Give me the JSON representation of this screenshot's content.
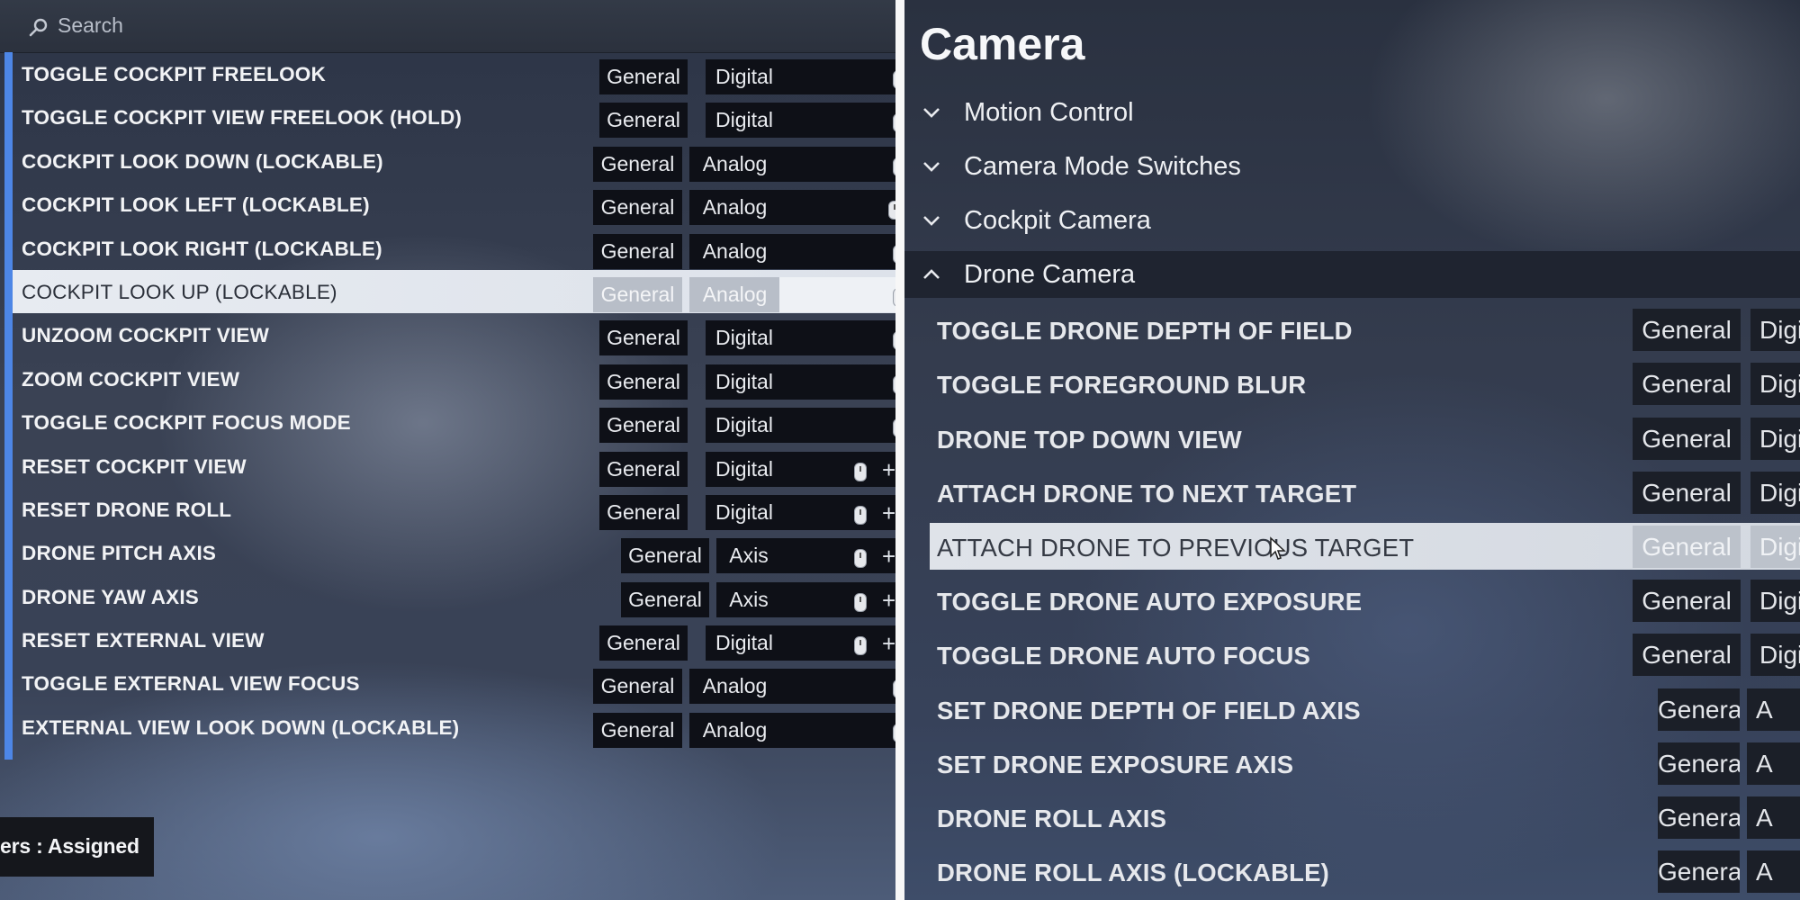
{
  "left_panel": {
    "search": {
      "placeholder": "Search"
    },
    "rows": [
      {
        "name": "TOGGLE COCKPIT FREELOOK",
        "category": "General",
        "type": "Digital"
      },
      {
        "name": "TOGGLE COCKPIT VIEW FREELOOK (HOLD)",
        "category": "General",
        "type": "Digital"
      },
      {
        "name": "COCKPIT LOOK DOWN (LOCKABLE)",
        "category": "General",
        "type": "Analog"
      },
      {
        "name": "COCKPIT LOOK LEFT (LOCKABLE)",
        "category": "General",
        "type": "Analog"
      },
      {
        "name": "COCKPIT LOOK RIGHT (LOCKABLE)",
        "category": "General",
        "type": "Analog"
      },
      {
        "name": "COCKPIT LOOK UP (LOCKABLE)",
        "category": "General",
        "type": "Analog",
        "selected": true
      },
      {
        "name": "UNZOOM COCKPIT VIEW",
        "category": "General",
        "type": "Digital"
      },
      {
        "name": "ZOOM COCKPIT VIEW",
        "category": "General",
        "type": "Digital"
      },
      {
        "name": "TOGGLE COCKPIT FOCUS MODE",
        "category": "General",
        "type": "Digital"
      },
      {
        "name": "RESET COCKPIT VIEW",
        "category": "General",
        "type": "Digital"
      },
      {
        "name": "RESET DRONE ROLL",
        "category": "General",
        "type": "Digital"
      },
      {
        "name": "DRONE PITCH AXIS",
        "category": "General",
        "type": "Axis"
      },
      {
        "name": "DRONE YAW AXIS",
        "category": "General",
        "type": "Axis"
      },
      {
        "name": "RESET EXTERNAL VIEW",
        "category": "General",
        "type": "Digital"
      },
      {
        "name": "TOGGLE EXTERNAL VIEW FOCUS",
        "category": "General",
        "type": "Analog"
      },
      {
        "name": "EXTERNAL VIEW LOOK DOWN (LOCKABLE)",
        "category": "General",
        "type": "Analog"
      }
    ],
    "filter_label": "ers : Assigned"
  },
  "right_panel": {
    "title": "Camera",
    "categories": [
      {
        "label": "Motion Control",
        "expanded": false
      },
      {
        "label": "Camera Mode Switches",
        "expanded": false
      },
      {
        "label": "Cockpit Camera",
        "expanded": false
      },
      {
        "label": "Drone Camera",
        "expanded": true
      }
    ],
    "rows": [
      {
        "name": "TOGGLE DRONE DEPTH OF FIELD",
        "category": "General",
        "type": "Digi"
      },
      {
        "name": "TOGGLE FOREGROUND BLUR",
        "category": "General",
        "type": "Digi"
      },
      {
        "name": "DRONE TOP DOWN VIEW",
        "category": "General",
        "type": "Digi"
      },
      {
        "name": "ATTACH DRONE TO NEXT TARGET",
        "category": "General",
        "type": "Digi"
      },
      {
        "name": "ATTACH DRONE TO PREVIOUS TARGET",
        "category": "General",
        "type": "Digi",
        "selected": true
      },
      {
        "name": "TOGGLE DRONE AUTO EXPOSURE",
        "category": "General",
        "type": "Digi"
      },
      {
        "name": "TOGGLE DRONE AUTO FOCUS",
        "category": "General",
        "type": "Digi"
      },
      {
        "name": "SET DRONE DEPTH OF FIELD AXIS",
        "category": "General",
        "type": "A"
      },
      {
        "name": "SET DRONE EXPOSURE AXIS",
        "category": "General",
        "type": "A"
      },
      {
        "name": "DRONE ROLL AXIS",
        "category": "General",
        "type": "A"
      },
      {
        "name": "DRONE ROLL AXIS (LOCKABLE)",
        "category": "General",
        "type": "A"
      }
    ]
  },
  "colors": {
    "accent": "#4d86e6",
    "selected_row": "#e2e6ec",
    "chip": "#0e1017"
  }
}
